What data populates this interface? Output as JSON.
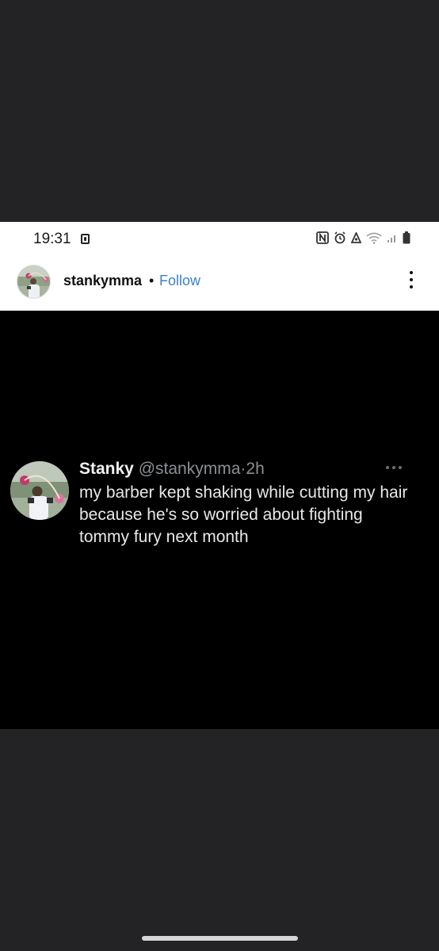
{
  "status_bar": {
    "time": "19:31",
    "icons": [
      "screenshot-icon",
      "nfc-icon",
      "alarm-icon",
      "data-saver-icon",
      "wifi-icon",
      "signal-icon",
      "battery-icon"
    ]
  },
  "post_header": {
    "username": "stankymma",
    "separator": "•",
    "follow_label": "Follow",
    "follow_color": "#3b82c4",
    "more_icon": "more-vertical-icon"
  },
  "tweet": {
    "display_name": "Stanky",
    "handle": "@stankymma",
    "separator": "·",
    "time_ago": "2h",
    "more_icon": "more-horizontal-icon",
    "text": "my barber kept shaking while cutting my hair because he's so worried about fighting tommy fury next month"
  },
  "colors": {
    "background": "#232325",
    "tweet_background": "#000000",
    "header_background": "#ffffff"
  }
}
